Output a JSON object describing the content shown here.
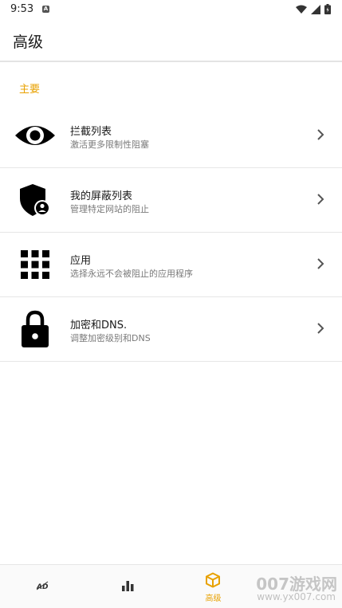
{
  "status_bar": {
    "time": "9:53",
    "notification_badge": "A"
  },
  "app_bar": {
    "title": "高级"
  },
  "section": {
    "header": "主要"
  },
  "items": [
    {
      "title": "拦截列表",
      "subtitle": "激活更多限制性阻塞",
      "icon": "eye-icon"
    },
    {
      "title": "我的屏蔽列表",
      "subtitle": "管理特定网站的阻止",
      "icon": "shield-user-icon"
    },
    {
      "title": "应用",
      "subtitle": "选择永远不会被阻止的应用程序",
      "icon": "grid-apps-icon"
    },
    {
      "title": "加密和DNS.",
      "subtitle": "调整加密级别和DNS",
      "icon": "lock-icon"
    }
  ],
  "bottom_nav": {
    "tabs": [
      {
        "name": "ad-block-tab",
        "label": ""
      },
      {
        "name": "stats-tab",
        "label": ""
      },
      {
        "name": "advanced-tab",
        "label": "高级",
        "active": true
      }
    ]
  },
  "watermark": {
    "main": "007游戏网",
    "sub": "www.yx007.com"
  },
  "colors": {
    "accent": "#e8a100",
    "divider": "#e6e6e6",
    "text_secondary": "#7a7a7a"
  }
}
